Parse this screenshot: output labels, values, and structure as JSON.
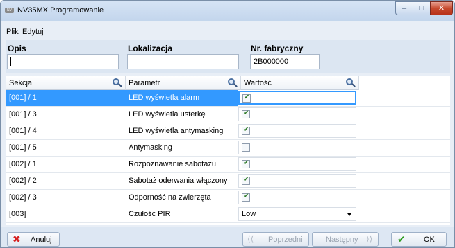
{
  "window": {
    "title": "NV35MX Programowanie",
    "app_icon_text": "NV"
  },
  "menu": {
    "plik": "P",
    "plik_rest": "lik",
    "edytuj": "E",
    "edytuj_rest": "dytuj"
  },
  "fields": {
    "opis_label": "Opis",
    "opis_value": "",
    "lokalizacja_label": "Lokalizacja",
    "lokalizacja_value": "",
    "nr_label": "Nr. fabryczny",
    "nr_value": "2B000000"
  },
  "grid": {
    "headers": [
      "Sekcja",
      "Parametr",
      "Wartość"
    ],
    "rows": [
      {
        "sekcja": "[001] / 1",
        "parametr": "LED wyświetla alarm",
        "type": "checkbox",
        "checked": true,
        "selected": true
      },
      {
        "sekcja": "[001] / 3",
        "parametr": "LED wyświetla usterkę",
        "type": "checkbox",
        "checked": true
      },
      {
        "sekcja": "[001] / 4",
        "parametr": "LED wyświetla antymasking",
        "type": "checkbox",
        "checked": true
      },
      {
        "sekcja": "[001] / 5",
        "parametr": "Antymasking",
        "type": "checkbox",
        "checked": false
      },
      {
        "sekcja": "[002] / 1",
        "parametr": "Rozpoznawanie sabotażu",
        "type": "checkbox",
        "checked": true
      },
      {
        "sekcja": "[002] / 2",
        "parametr": "Sabotaż oderwania włączony",
        "type": "checkbox",
        "checked": true
      },
      {
        "sekcja": "[002] / 3",
        "parametr": "Odporność na zwierzęta",
        "type": "checkbox",
        "checked": true
      },
      {
        "sekcja": "[003]",
        "parametr": "Czułość PIR",
        "type": "dropdown",
        "value": "Low"
      }
    ]
  },
  "buttons": {
    "cancel": "Anuluj",
    "previous": "Poprzedni",
    "next": "Następny",
    "ok": "OK"
  },
  "colors": {
    "selection": "#3399ff",
    "close_button": "#c74a2e",
    "check_green": "#2b7a24"
  }
}
